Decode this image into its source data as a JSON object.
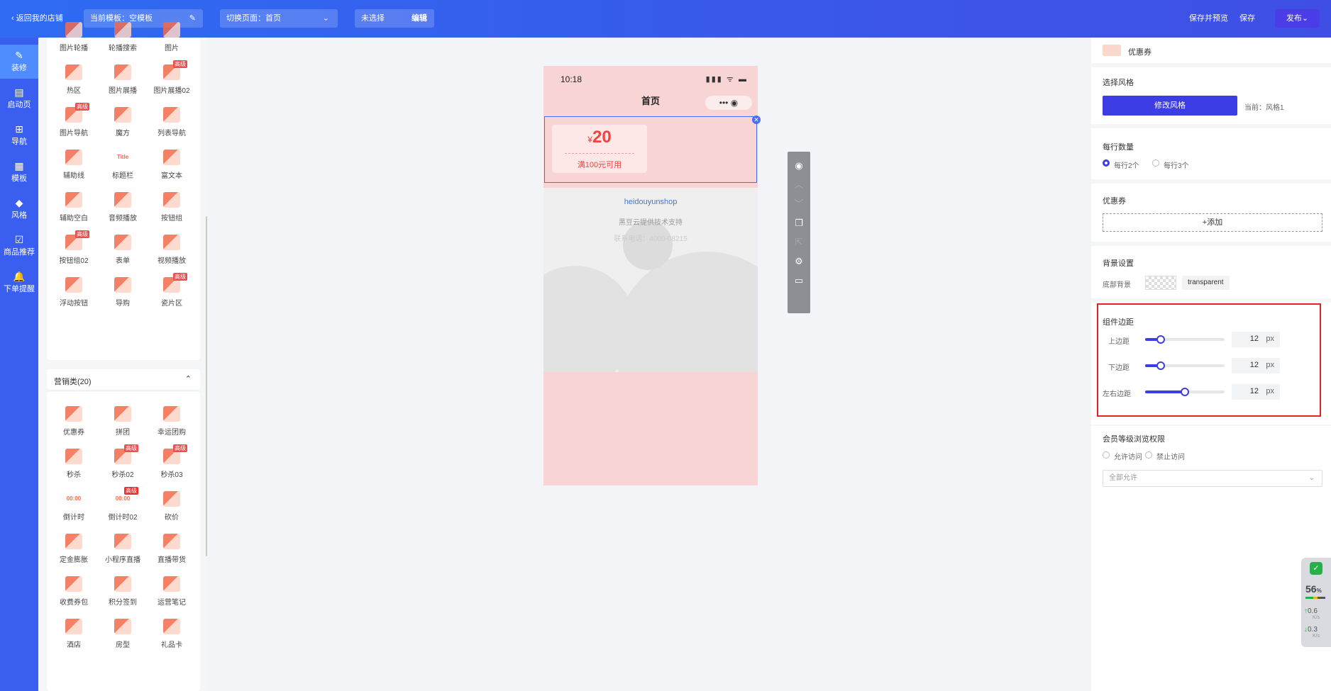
{
  "topbar": {
    "back_label": "返回我的店铺",
    "template_label": "当前模板：空模板",
    "page_label": "切换页面：首页",
    "selection_label": "未选择",
    "edit_label": "编辑",
    "save_preview_label": "保存并预览",
    "save_label": "保存",
    "publish_label": "发布"
  },
  "nav": [
    {
      "label": "装修",
      "icon": "brush-icon"
    },
    {
      "label": "启动页",
      "icon": "launch-page-icon"
    },
    {
      "label": "导航",
      "icon": "grid-nav-icon"
    },
    {
      "label": "模板",
      "icon": "template-icon"
    },
    {
      "label": "风格",
      "icon": "palette-icon"
    },
    {
      "label": "商品推荐",
      "icon": "recommend-icon"
    },
    {
      "label": "下单提醒",
      "icon": "bell-icon"
    }
  ],
  "basic_components": [
    {
      "label": "图片轮播"
    },
    {
      "label": "轮播搜索"
    },
    {
      "label": "图片"
    },
    {
      "label": "热区"
    },
    {
      "label": "图片展播"
    },
    {
      "label": "图片展播02",
      "badge": "高级"
    },
    {
      "label": "图片导航",
      "badge": "高级"
    },
    {
      "label": "魔方"
    },
    {
      "label": "列表导航"
    },
    {
      "label": "辅助线"
    },
    {
      "label": "标题栏",
      "icon_text": "Title"
    },
    {
      "label": "富文本"
    },
    {
      "label": "辅助空白"
    },
    {
      "label": "音频播放"
    },
    {
      "label": "按钮组"
    },
    {
      "label": "按钮组02",
      "badge": "高级"
    },
    {
      "label": "表单"
    },
    {
      "label": "视频播放"
    },
    {
      "label": "浮动按钮"
    },
    {
      "label": "导购"
    },
    {
      "label": "瓷片区",
      "badge": "高级"
    }
  ],
  "marketing_group": {
    "label": "营销类(20)"
  },
  "marketing_components": [
    {
      "label": "优惠券"
    },
    {
      "label": "拼团"
    },
    {
      "label": "幸运团购"
    },
    {
      "label": "秒杀"
    },
    {
      "label": "秒杀02",
      "badge": "高级"
    },
    {
      "label": "秒杀03",
      "badge": "高级"
    },
    {
      "label": "倒计时",
      "icon_text": "00:00"
    },
    {
      "label": "倒计时02",
      "badge": "高级",
      "icon_text": "00:00"
    },
    {
      "label": "砍价"
    },
    {
      "label": "定金膨胀"
    },
    {
      "label": "小程序直播"
    },
    {
      "label": "直播带货"
    },
    {
      "label": "收费券包"
    },
    {
      "label": "积分签到"
    },
    {
      "label": "运营笔记"
    },
    {
      "label": "酒店"
    },
    {
      "label": "房型"
    },
    {
      "label": "礼品卡"
    }
  ],
  "phone": {
    "time": "10:18",
    "signal": "▮▮▮ ᯤ ▬",
    "title": "首页",
    "capsule": "••• ◉",
    "coupon": {
      "currency": "¥",
      "amount": "20",
      "condition": "满100元可用"
    },
    "brand": "heidouyunshop",
    "support": "黑豆云提供技术支持",
    "contact": "联系电话：4000-08215"
  },
  "toolbar": [
    {
      "icon": "eye-icon",
      "glyph": "◉",
      "enabled": true
    },
    {
      "icon": "arrow-up-icon",
      "glyph": "︿",
      "enabled": false
    },
    {
      "icon": "arrow-down-icon",
      "glyph": "﹀",
      "enabled": false
    },
    {
      "icon": "copy-icon",
      "glyph": "❐",
      "enabled": true
    },
    {
      "icon": "export-icon",
      "glyph": "⇱",
      "enabled": false
    },
    {
      "icon": "settings-icon",
      "glyph": "⚙",
      "enabled": true
    },
    {
      "icon": "note-icon",
      "glyph": "▭",
      "enabled": true
    }
  ],
  "props": {
    "header_title": "优惠券",
    "style_section": {
      "title": "选择风格",
      "button": "修改风格",
      "current": "当前：风格1"
    },
    "per_row": {
      "title": "每行数量",
      "options": [
        "每行2个",
        "每行3个"
      ],
      "selected": "每行2个"
    },
    "coupon_section": {
      "title": "优惠券",
      "add_label": "+添加"
    },
    "background": {
      "title": "背景设置",
      "label": "底部背景",
      "value": "transparent"
    },
    "margins": {
      "title": "组件边距",
      "rows": [
        {
          "label": "上边距",
          "value": "12",
          "unit": "px",
          "level": 0.2
        },
        {
          "label": "下边距",
          "value": "12",
          "unit": "px",
          "level": 0.2
        },
        {
          "label": "左右边距",
          "value": "12",
          "unit": "px",
          "level": 0.5
        }
      ]
    },
    "permissions": {
      "title": "会员等级浏览权限",
      "options": [
        "允许访问",
        "禁止访问"
      ],
      "select_value": "全部允许"
    }
  },
  "net_widget": {
    "percent": "56",
    "percent_unit": "%",
    "up": "0.6",
    "down": "0.3",
    "rate_unit": "K/s"
  },
  "colors": {
    "accent": "#3d3de6",
    "highlight": "#e82020",
    "coupon_red": "#f0443e",
    "icon_orange": "#f26b4b"
  }
}
